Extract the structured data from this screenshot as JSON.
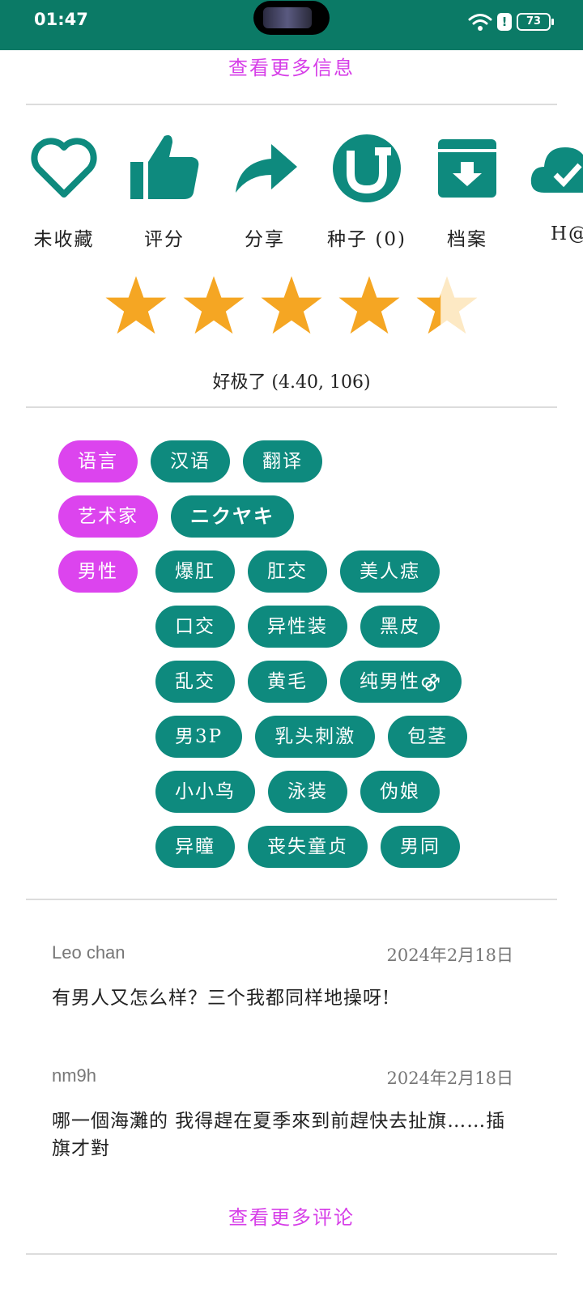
{
  "status_bar": {
    "time": "01:47",
    "alert": "!",
    "battery": "73"
  },
  "more_info_link": "查看更多信息",
  "actions": [
    {
      "label": "未收藏",
      "icon": "heart-outline-icon"
    },
    {
      "label": "评分",
      "icon": "thumbs-up-icon"
    },
    {
      "label": "分享",
      "icon": "share-arrow-icon"
    },
    {
      "label": "种子 (0)",
      "icon": "torrent-icon"
    },
    {
      "label": "档案",
      "icon": "archive-download-icon"
    },
    {
      "label": "H@",
      "icon": "cloud-check-icon"
    }
  ],
  "rating": {
    "value": 4.4,
    "max": 5,
    "text": "好极了 (4.40, 106)",
    "color": "#f5a623"
  },
  "tags": {
    "language": {
      "category": "语言",
      "items": [
        "汉语",
        "翻译"
      ]
    },
    "artist": {
      "category": "艺术家",
      "items": [
        "ニクヤキ"
      ]
    },
    "male": {
      "category": "男性",
      "rows": [
        [
          "爆肛",
          "肛交",
          "美人痣"
        ],
        [
          "口交",
          "异性装",
          "黑皮"
        ],
        [
          "乱交",
          "黄毛",
          "纯男性⚣"
        ],
        [
          "男3P",
          "乳头刺激",
          "包茎"
        ],
        [
          "小小鸟",
          "泳装",
          "伪娘"
        ],
        [
          "异瞳",
          "丧失童贞",
          "男同"
        ]
      ]
    }
  },
  "comments": [
    {
      "author": "Leo chan",
      "date": "2024年2月18日",
      "body": "有男人又怎么样？三个我都同样地操呀!"
    },
    {
      "author": "nm9h",
      "date": "2024年2月18日",
      "body": "哪一個海灘的 我得趕在夏季來到前趕快去扯旗……插旗才對"
    }
  ],
  "more_comments_link": "查看更多评论",
  "colors": {
    "primary": "#0e8a7e",
    "status_bar": "#0b7a66",
    "accent": "#d63ee8",
    "tag_category": "#dc44ee"
  }
}
